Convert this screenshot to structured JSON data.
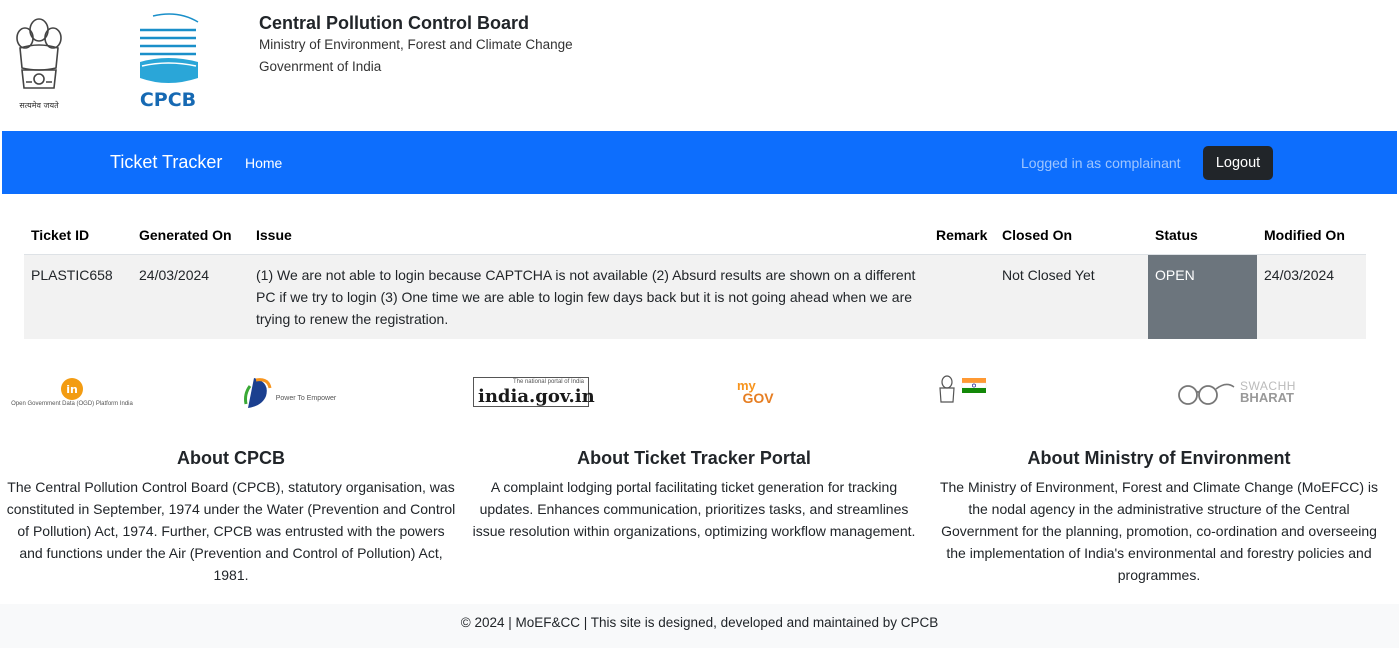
{
  "header": {
    "org_name": "Central Pollution Control Board",
    "ministry": "Ministry of Environment, Forest and Climate Change",
    "government": "Govenrment of India",
    "emblem_caption": "सत्यमेव जयते",
    "cpcb_logo_text": "CPCB"
  },
  "navbar": {
    "brand": "Ticket Tracker",
    "home": "Home",
    "logged_in": "Logged in as complainant",
    "logout": "Logout",
    "color": "#0d6efd"
  },
  "table": {
    "headers": [
      "Ticket ID",
      "Generated On",
      "Issue",
      "Remark",
      "Closed On",
      "Status",
      "Modified On"
    ],
    "rows": [
      {
        "ticket_id": "PLASTIC658",
        "generated_on": "24/03/2024",
        "issue": "(1) We are not able to login because CAPTCHA is not available (2) Absurd results are shown on a different PC if we try to login (3) One time we are able to login few days back but it is not going ahead when we are trying to renew the registration.",
        "remark": "",
        "closed_on": "Not Closed Yet",
        "status": "OPEN",
        "modified_on": "24/03/2024"
      }
    ]
  },
  "logos": {
    "ogd": "Open Government Data (OGD) Platform India",
    "digital_india": "Power To Empower",
    "india_gov": "india.gov.in",
    "india_gov_tag": "The national portal of India",
    "mygov_my": "my",
    "mygov_gov": "GOV",
    "swachh": "SWACHH",
    "bharat": "BHARAT"
  },
  "about": {
    "cpcb_title": "About CPCB",
    "cpcb_text": "The Central Pollution Control Board (CPCB), statutory organisation, was constituted in September, 1974 under the Water (Prevention and Control of Pollution) Act, 1974. Further, CPCB was entrusted with the powers and functions under the Air (Prevention and Control of Pollution) Act, 1981.",
    "portal_title": "About Ticket Tracker Portal",
    "portal_text": "A complaint lodging portal facilitating ticket generation for tracking updates. Enhances communication, prioritizes tasks, and streamlines issue resolution within organizations, optimizing workflow management.",
    "ministry_title": "About Ministry of Environment",
    "ministry_text": "The Ministry of Environment, Forest and Climate Change (MoEFCC) is the nodal agency in the administrative structure of the Central Government for the planning, promotion, co-ordination and overseeing the implementation of India's environmental and forestry policies and programmes."
  },
  "footer": {
    "text": "© 2024 | MoEF&CC | This site is designed, developed and maintained by CPCB"
  }
}
